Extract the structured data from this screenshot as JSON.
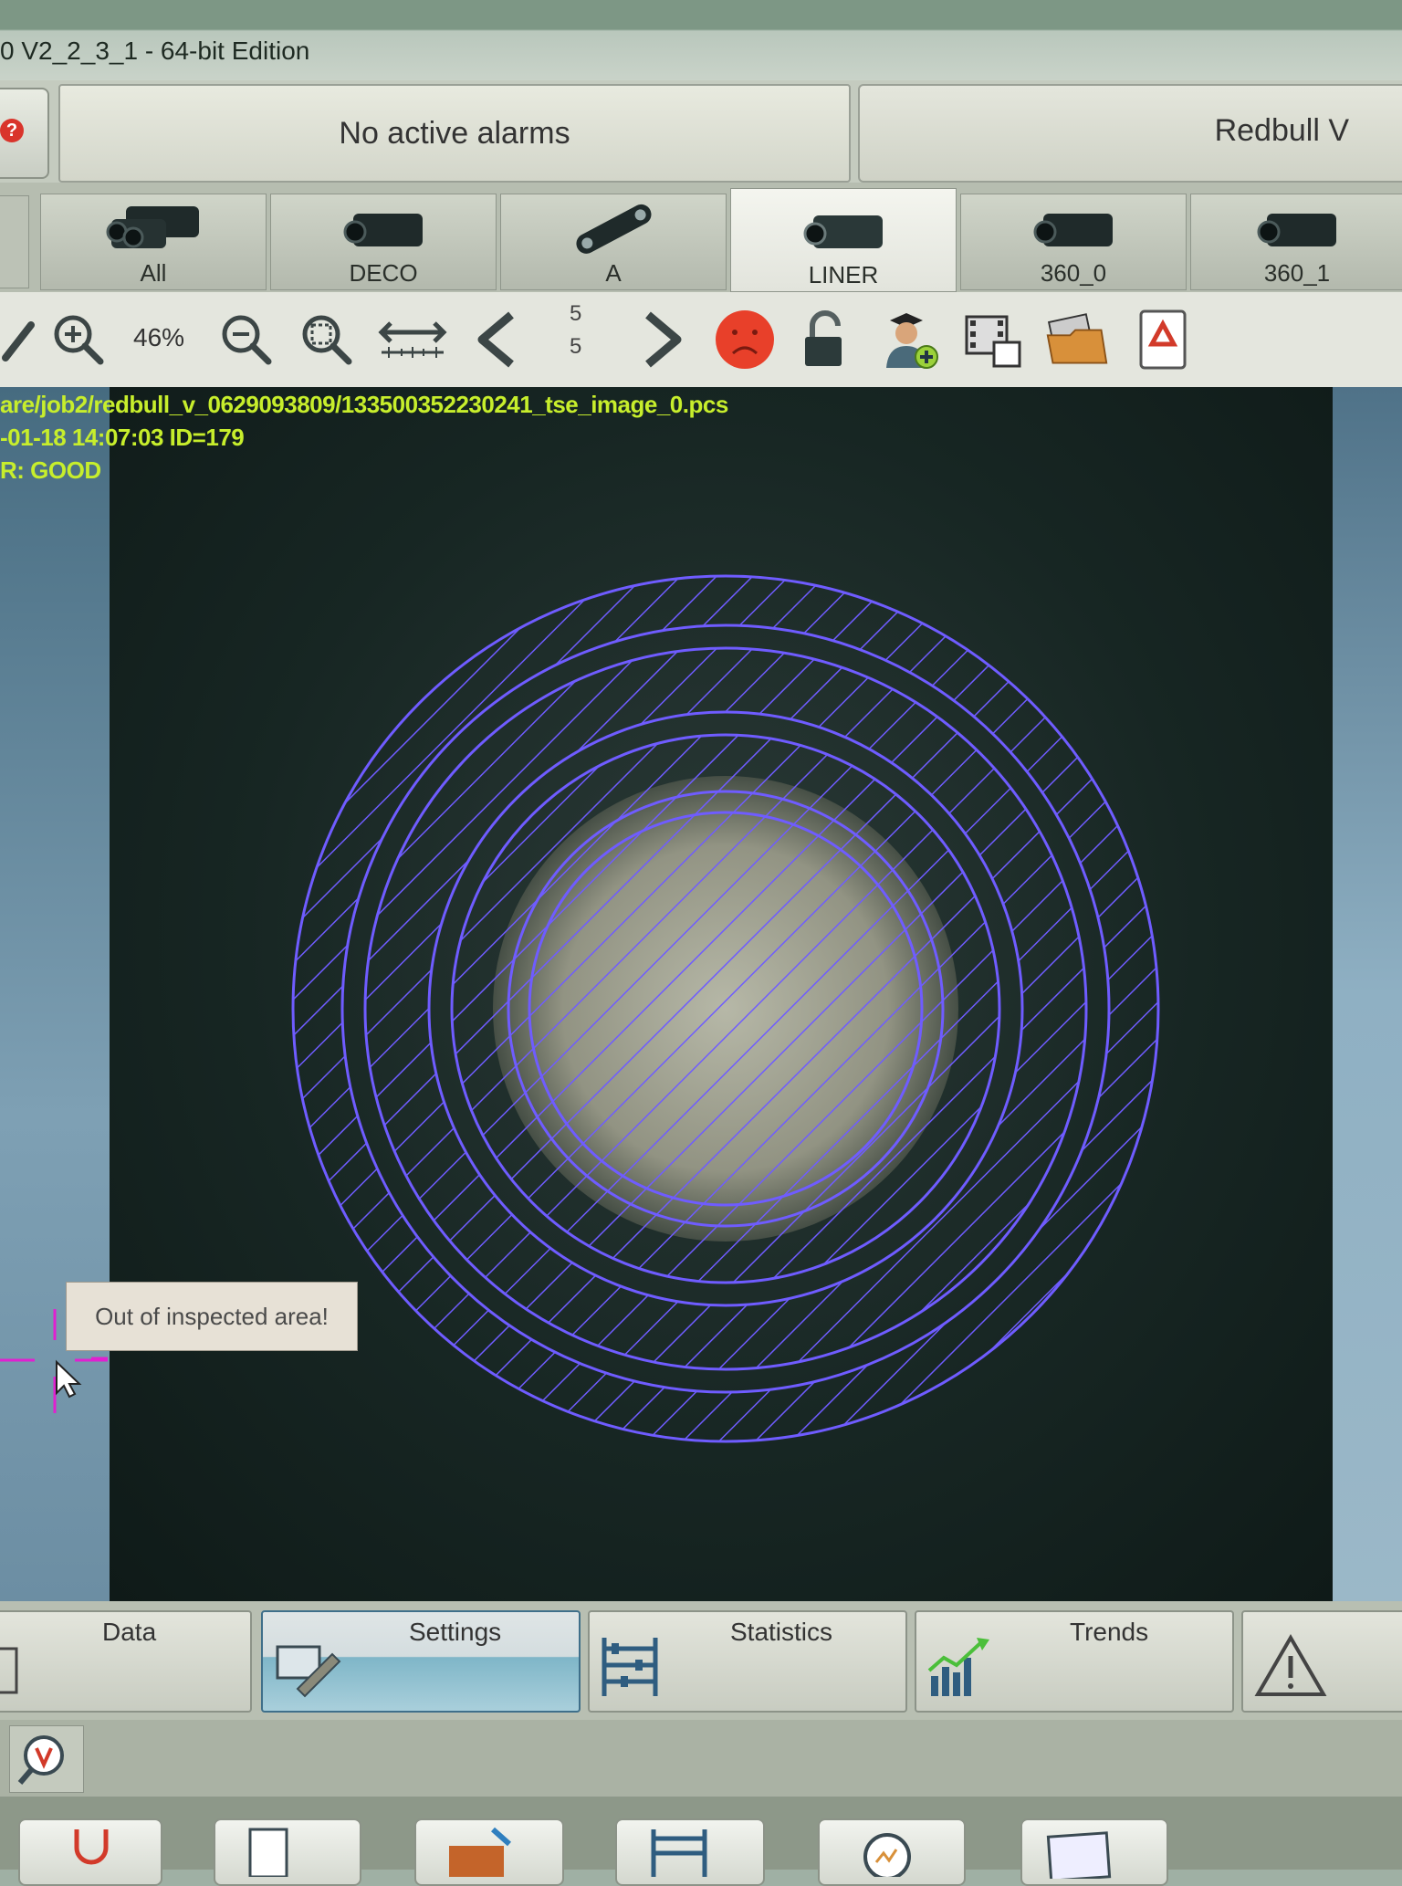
{
  "window": {
    "title": "0 V2_2_3_1 - 64-bit Edition"
  },
  "alarms": {
    "text": "No active alarms"
  },
  "job": {
    "name": "Redbull V"
  },
  "cameras": [
    {
      "label": "All"
    },
    {
      "label": "DECO"
    },
    {
      "label": "A"
    },
    {
      "label": "LINER"
    },
    {
      "label": "360_0"
    },
    {
      "label": "360_1"
    }
  ],
  "toolbar": {
    "zoom_level": "46%",
    "page_current": "5",
    "page_total": "5"
  },
  "viewer": {
    "file_path": "are/job2/redbull_v_0629093809/133500352230241_tse_image_0.pcs",
    "timestamp_id": "-01-18 14:07:03 ID=179",
    "result": "R: GOOD",
    "tooltip": "Out of inspected area!"
  },
  "tabs": [
    {
      "label": "Data"
    },
    {
      "label": "Settings"
    },
    {
      "label": "Statistics"
    },
    {
      "label": "Trends"
    }
  ],
  "colors": {
    "overlay": "#6f5cff",
    "info_text": "#c7ee2c",
    "status_bad": "#e8402a",
    "crosshair": "#e020d0"
  }
}
